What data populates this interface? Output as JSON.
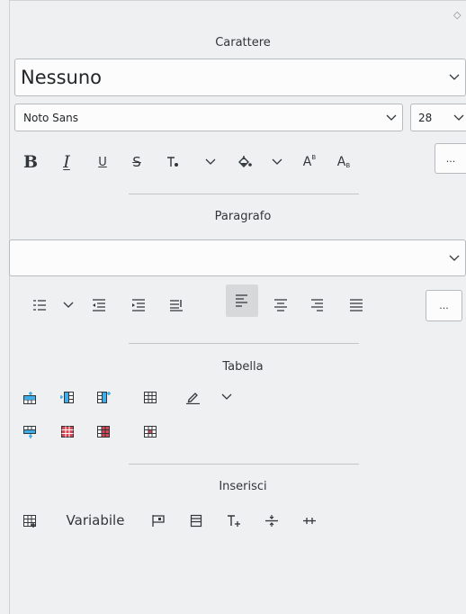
{
  "character": {
    "title": "Carattere",
    "style_value": "Nessuno",
    "font_value": "Noto Sans",
    "size_value": "28",
    "bold": "B",
    "italic": "I",
    "underline": "U",
    "strikethrough": "S",
    "superscript": "A",
    "more_label": "..."
  },
  "paragraph": {
    "title": "Paragrafo",
    "style_value": "",
    "more_label": "..."
  },
  "table": {
    "title": "Tabella"
  },
  "insert": {
    "title": "Inserisci",
    "variable_label": "Variabile"
  },
  "colors": {
    "accent_blue": "#3daee9",
    "table_red": "#da4453",
    "text": "#31363b"
  }
}
